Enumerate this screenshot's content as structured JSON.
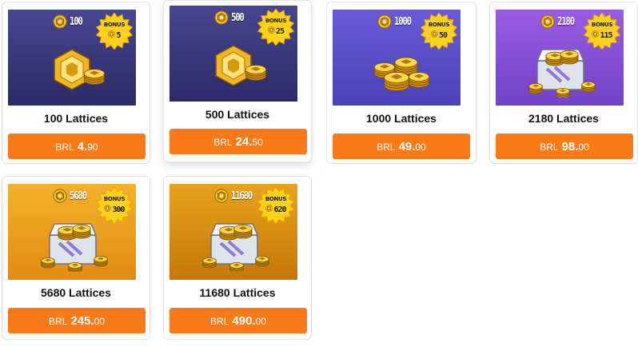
{
  "products": [
    {
      "amount": "100",
      "bonus_label": "BONUS",
      "bonus": "5",
      "title": "100 Lattices",
      "currency": "BRL",
      "price_int": "4.",
      "price_dec": "90",
      "bg_top": "#48468f",
      "bg_bottom": "#2c2a68",
      "art": "coins"
    },
    {
      "amount": "500",
      "bonus_label": "BONUS",
      "bonus": "25",
      "title": "500 Lattices",
      "currency": "BRL",
      "price_int": "24.",
      "price_dec": "50",
      "bg_top": "#48468f",
      "bg_bottom": "#2c2a68",
      "art": "coins"
    },
    {
      "amount": "1000",
      "bonus_label": "BONUS",
      "bonus": "50",
      "title": "1000 Lattices",
      "currency": "BRL",
      "price_int": "49.",
      "price_dec": "00",
      "bg_top": "#6a5ad8",
      "bg_bottom": "#4a40b6",
      "art": "coin-pile"
    },
    {
      "amount": "2180",
      "bonus_label": "BONUS",
      "bonus": "115",
      "title": "2180 Lattices",
      "currency": "BRL",
      "price_int": "98.",
      "price_dec": "00",
      "bg_top": "#9a5ce4",
      "bg_bottom": "#7142c6",
      "art": "chest"
    },
    {
      "amount": "5680",
      "bonus_label": "BONUS",
      "bonus": "300",
      "title": "5680 Lattices",
      "currency": "BRL",
      "price_int": "245.",
      "price_dec": "00",
      "bg_top": "#f3b12c",
      "bg_bottom": "#e38c12",
      "art": "chest"
    },
    {
      "amount": "11680",
      "bonus_label": "BONUS",
      "bonus": "620",
      "title": "11680 Lattices",
      "currency": "BRL",
      "price_int": "490.",
      "price_dec": "00",
      "bg_top": "#e7a21e",
      "bg_bottom": "#c57805",
      "art": "chest"
    }
  ],
  "colors": {
    "button": "#fa7a1a",
    "coin_gold": "#f2c230",
    "star_yellow": "#ffd21a"
  }
}
